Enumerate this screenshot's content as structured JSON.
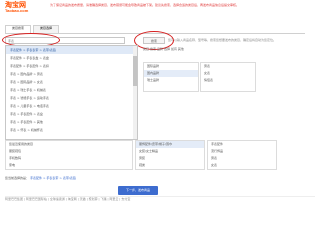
{
  "header": {
    "logo_glyph": "淘宝网",
    "logo_site": "Taobao.com",
    "notice": "为了保证商品的发布质量，请准确选择类目，发布错误可能会导致商品被下架。建议先搜索，选择合适的类目后，再发布商品信息后提交审核。"
  },
  "tabs": [
    {
      "label": "类目搜索"
    },
    {
      "label": "类目选择"
    }
  ],
  "search": {
    "input_value": "手表",
    "button_label": "搜索",
    "hint": "您可以输入商品名称、型号等，搜索您想要发布的类目，确定后将自动为您定位。"
  },
  "dropdown": {
    "items": [
      "手表配件 > 手表表带 > 表带/表链",
      "手表配件 > 手表表盘 > 表盘",
      "手表配件 > 手表配件 > 表扣",
      "手表 > 国内品牌 > 男表",
      "手表 > 国际品牌 > 女表",
      "手表 > 瑞士手表 > 机械表",
      "手表 > 智能手表 > 运动手表",
      "手表 > 儿童手表 > 电话手表",
      "手表 > 手表配件 > 表盒",
      "手表 > 手表配件 > 其他",
      "手表 > 怀表 > 机械怀表"
    ],
    "selected_index": 0
  },
  "right_panel": {
    "tabs": [
      "类目",
      "搜索",
      "品牌",
      "选择",
      "如有",
      "其他"
    ],
    "rows_a": [
      "国际品牌",
      "国内品牌",
      "瑞士品牌"
    ],
    "rows_b": [
      "男表",
      "女表",
      "情侣表"
    ]
  },
  "bottom_table": {
    "col1": [
      "您最近使用的类目",
      "服装鞋包",
      "手机数码",
      "家电",
      "美妆护肤"
    ],
    "col2": [
      "服饰配件/皮带/帽子/围巾",
      "女装/女士精品",
      "男装",
      "鞋类"
    ],
    "col3": [
      "手表配件",
      "流行饰品",
      "男表",
      "女表"
    ]
  },
  "breadcrumb": {
    "prefix": "您当前选择的是：",
    "path": "手表配件 > 手表表带 > 表带/表链"
  },
  "next_button": {
    "label": "下一步，发布商品"
  },
  "footer": {
    "links": "阿里巴巴集团 | 阿里巴巴国际站 | 全球速卖通 | 淘宝网 | 天猫 | 聚划算 | 飞猪 | 阿里云 | 支付宝"
  }
}
